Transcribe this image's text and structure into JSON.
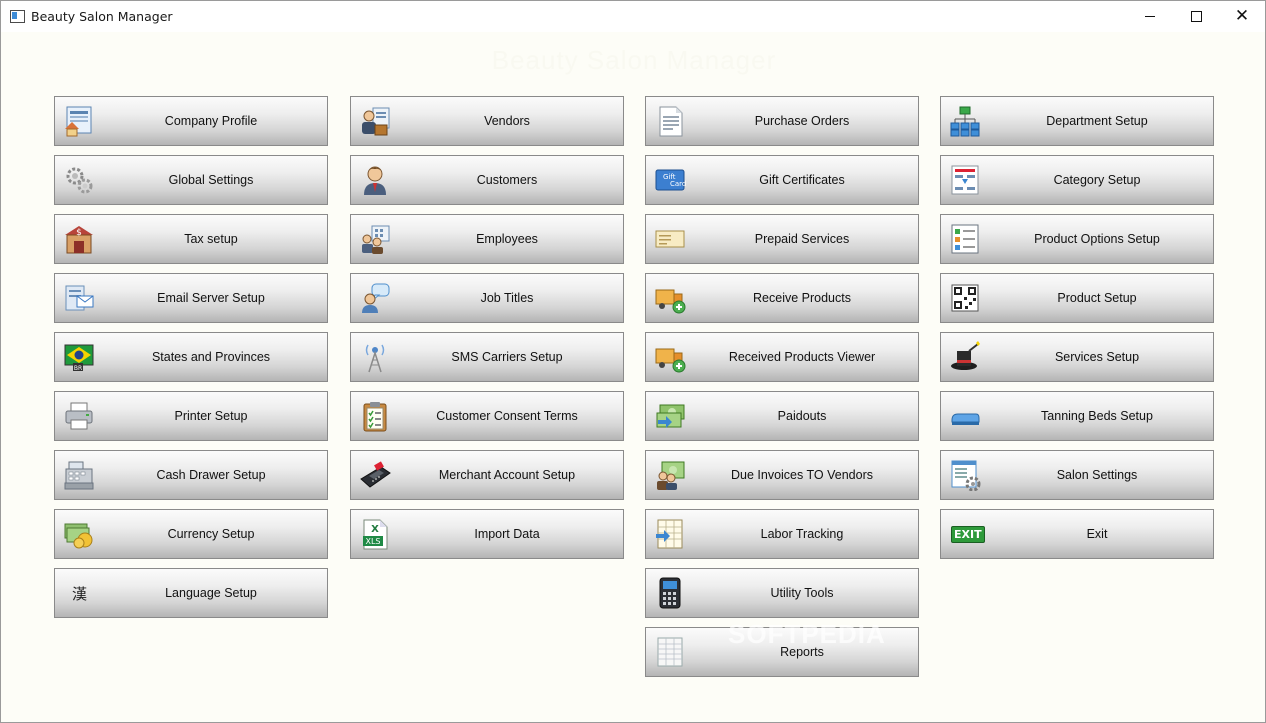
{
  "window": {
    "title": "Beauty Salon Manager"
  },
  "heading": "Beauty Salon Manager",
  "watermark": "SOFTPEDIA",
  "columns": [
    [
      {
        "label": "Company Profile",
        "icon": "company-icon"
      },
      {
        "label": "Global Settings",
        "icon": "gears-icon"
      },
      {
        "label": "Tax setup",
        "icon": "tax-icon"
      },
      {
        "label": "Email Server Setup",
        "icon": "email-server-icon"
      },
      {
        "label": "States and Provinces",
        "icon": "flag-icon"
      },
      {
        "label": "Printer Setup",
        "icon": "printer-icon"
      },
      {
        "label": "Cash Drawer Setup",
        "icon": "cash-register-icon"
      },
      {
        "label": "Currency Setup",
        "icon": "currency-icon"
      },
      {
        "label": "Language Setup",
        "icon": "language-icon",
        "glyph": "漢"
      }
    ],
    [
      {
        "label": "Vendors",
        "icon": "vendors-icon"
      },
      {
        "label": "Customers",
        "icon": "customer-icon"
      },
      {
        "label": "Employees",
        "icon": "employees-icon"
      },
      {
        "label": "Job Titles",
        "icon": "chat-user-icon"
      },
      {
        "label": "SMS Carriers Setup",
        "icon": "antenna-icon"
      },
      {
        "label": "Customer Consent Terms",
        "icon": "clipboard-icon"
      },
      {
        "label": "Merchant Account Setup",
        "icon": "card-terminal-icon"
      },
      {
        "label": "Import Data",
        "icon": "xls-icon"
      }
    ],
    [
      {
        "label": "Purchase Orders",
        "icon": "document-icon"
      },
      {
        "label": "Gift Certificates",
        "icon": "gift-card-icon"
      },
      {
        "label": "Prepaid Services",
        "icon": "ticket-icon"
      },
      {
        "label": "Receive Products",
        "icon": "truck-add-icon"
      },
      {
        "label": "Received Products Viewer",
        "icon": "truck-view-icon"
      },
      {
        "label": "Paidouts",
        "icon": "money-arrow-icon"
      },
      {
        "label": "Due Invoices TO Vendors",
        "icon": "money-people-icon"
      },
      {
        "label": "Labor Tracking",
        "icon": "timesheet-icon"
      },
      {
        "label": "Utility Tools",
        "icon": "calculator-icon"
      },
      {
        "label": "Reports",
        "icon": "report-icon"
      }
    ],
    [
      {
        "label": "Department Setup",
        "icon": "org-chart-icon"
      },
      {
        "label": "Category Setup",
        "icon": "category-icon"
      },
      {
        "label": "Product Options Setup",
        "icon": "options-list-icon"
      },
      {
        "label": "Product Setup",
        "icon": "qr-code-icon"
      },
      {
        "label": "Services Setup",
        "icon": "magic-hat-icon"
      },
      {
        "label": "Tanning Beds Setup",
        "icon": "tanning-bed-icon"
      },
      {
        "label": "Salon Settings",
        "icon": "salon-settings-icon"
      },
      {
        "label": "Exit",
        "icon": "exit-icon",
        "glyph": "EXIT"
      }
    ]
  ]
}
